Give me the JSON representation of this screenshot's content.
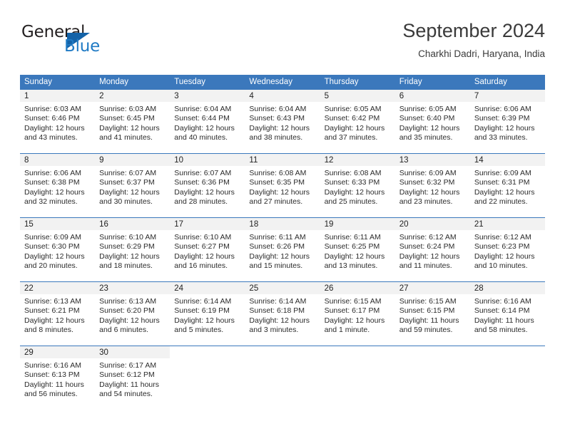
{
  "brand": {
    "name_part1": "General",
    "name_part2": "Blue",
    "triangle_icon": "triangle-icon",
    "accent_color": "#1463a8",
    "text_color": "#231f20"
  },
  "header": {
    "title": "September 2024",
    "subtitle": "Charkhi Dadri, Haryana, India"
  },
  "calendar": {
    "header_bg": "#3b78bc",
    "daynum_bg": "#f2f2f2",
    "weekdays": [
      "Sunday",
      "Monday",
      "Tuesday",
      "Wednesday",
      "Thursday",
      "Friday",
      "Saturday"
    ],
    "weeks": [
      [
        {
          "day": "1",
          "sunrise": "Sunrise: 6:03 AM",
          "sunset": "Sunset: 6:46 PM",
          "daylight1": "Daylight: 12 hours",
          "daylight2": "and 43 minutes."
        },
        {
          "day": "2",
          "sunrise": "Sunrise: 6:03 AM",
          "sunset": "Sunset: 6:45 PM",
          "daylight1": "Daylight: 12 hours",
          "daylight2": "and 41 minutes."
        },
        {
          "day": "3",
          "sunrise": "Sunrise: 6:04 AM",
          "sunset": "Sunset: 6:44 PM",
          "daylight1": "Daylight: 12 hours",
          "daylight2": "and 40 minutes."
        },
        {
          "day": "4",
          "sunrise": "Sunrise: 6:04 AM",
          "sunset": "Sunset: 6:43 PM",
          "daylight1": "Daylight: 12 hours",
          "daylight2": "and 38 minutes."
        },
        {
          "day": "5",
          "sunrise": "Sunrise: 6:05 AM",
          "sunset": "Sunset: 6:42 PM",
          "daylight1": "Daylight: 12 hours",
          "daylight2": "and 37 minutes."
        },
        {
          "day": "6",
          "sunrise": "Sunrise: 6:05 AM",
          "sunset": "Sunset: 6:40 PM",
          "daylight1": "Daylight: 12 hours",
          "daylight2": "and 35 minutes."
        },
        {
          "day": "7",
          "sunrise": "Sunrise: 6:06 AM",
          "sunset": "Sunset: 6:39 PM",
          "daylight1": "Daylight: 12 hours",
          "daylight2": "and 33 minutes."
        }
      ],
      [
        {
          "day": "8",
          "sunrise": "Sunrise: 6:06 AM",
          "sunset": "Sunset: 6:38 PM",
          "daylight1": "Daylight: 12 hours",
          "daylight2": "and 32 minutes."
        },
        {
          "day": "9",
          "sunrise": "Sunrise: 6:07 AM",
          "sunset": "Sunset: 6:37 PM",
          "daylight1": "Daylight: 12 hours",
          "daylight2": "and 30 minutes."
        },
        {
          "day": "10",
          "sunrise": "Sunrise: 6:07 AM",
          "sunset": "Sunset: 6:36 PM",
          "daylight1": "Daylight: 12 hours",
          "daylight2": "and 28 minutes."
        },
        {
          "day": "11",
          "sunrise": "Sunrise: 6:08 AM",
          "sunset": "Sunset: 6:35 PM",
          "daylight1": "Daylight: 12 hours",
          "daylight2": "and 27 minutes."
        },
        {
          "day": "12",
          "sunrise": "Sunrise: 6:08 AM",
          "sunset": "Sunset: 6:33 PM",
          "daylight1": "Daylight: 12 hours",
          "daylight2": "and 25 minutes."
        },
        {
          "day": "13",
          "sunrise": "Sunrise: 6:09 AM",
          "sunset": "Sunset: 6:32 PM",
          "daylight1": "Daylight: 12 hours",
          "daylight2": "and 23 minutes."
        },
        {
          "day": "14",
          "sunrise": "Sunrise: 6:09 AM",
          "sunset": "Sunset: 6:31 PM",
          "daylight1": "Daylight: 12 hours",
          "daylight2": "and 22 minutes."
        }
      ],
      [
        {
          "day": "15",
          "sunrise": "Sunrise: 6:09 AM",
          "sunset": "Sunset: 6:30 PM",
          "daylight1": "Daylight: 12 hours",
          "daylight2": "and 20 minutes."
        },
        {
          "day": "16",
          "sunrise": "Sunrise: 6:10 AM",
          "sunset": "Sunset: 6:29 PM",
          "daylight1": "Daylight: 12 hours",
          "daylight2": "and 18 minutes."
        },
        {
          "day": "17",
          "sunrise": "Sunrise: 6:10 AM",
          "sunset": "Sunset: 6:27 PM",
          "daylight1": "Daylight: 12 hours",
          "daylight2": "and 16 minutes."
        },
        {
          "day": "18",
          "sunrise": "Sunrise: 6:11 AM",
          "sunset": "Sunset: 6:26 PM",
          "daylight1": "Daylight: 12 hours",
          "daylight2": "and 15 minutes."
        },
        {
          "day": "19",
          "sunrise": "Sunrise: 6:11 AM",
          "sunset": "Sunset: 6:25 PM",
          "daylight1": "Daylight: 12 hours",
          "daylight2": "and 13 minutes."
        },
        {
          "day": "20",
          "sunrise": "Sunrise: 6:12 AM",
          "sunset": "Sunset: 6:24 PM",
          "daylight1": "Daylight: 12 hours",
          "daylight2": "and 11 minutes."
        },
        {
          "day": "21",
          "sunrise": "Sunrise: 6:12 AM",
          "sunset": "Sunset: 6:23 PM",
          "daylight1": "Daylight: 12 hours",
          "daylight2": "and 10 minutes."
        }
      ],
      [
        {
          "day": "22",
          "sunrise": "Sunrise: 6:13 AM",
          "sunset": "Sunset: 6:21 PM",
          "daylight1": "Daylight: 12 hours",
          "daylight2": "and 8 minutes."
        },
        {
          "day": "23",
          "sunrise": "Sunrise: 6:13 AM",
          "sunset": "Sunset: 6:20 PM",
          "daylight1": "Daylight: 12 hours",
          "daylight2": "and 6 minutes."
        },
        {
          "day": "24",
          "sunrise": "Sunrise: 6:14 AM",
          "sunset": "Sunset: 6:19 PM",
          "daylight1": "Daylight: 12 hours",
          "daylight2": "and 5 minutes."
        },
        {
          "day": "25",
          "sunrise": "Sunrise: 6:14 AM",
          "sunset": "Sunset: 6:18 PM",
          "daylight1": "Daylight: 12 hours",
          "daylight2": "and 3 minutes."
        },
        {
          "day": "26",
          "sunrise": "Sunrise: 6:15 AM",
          "sunset": "Sunset: 6:17 PM",
          "daylight1": "Daylight: 12 hours",
          "daylight2": "and 1 minute."
        },
        {
          "day": "27",
          "sunrise": "Sunrise: 6:15 AM",
          "sunset": "Sunset: 6:15 PM",
          "daylight1": "Daylight: 11 hours",
          "daylight2": "and 59 minutes."
        },
        {
          "day": "28",
          "sunrise": "Sunrise: 6:16 AM",
          "sunset": "Sunset: 6:14 PM",
          "daylight1": "Daylight: 11 hours",
          "daylight2": "and 58 minutes."
        }
      ],
      [
        {
          "day": "29",
          "sunrise": "Sunrise: 6:16 AM",
          "sunset": "Sunset: 6:13 PM",
          "daylight1": "Daylight: 11 hours",
          "daylight2": "and 56 minutes."
        },
        {
          "day": "30",
          "sunrise": "Sunrise: 6:17 AM",
          "sunset": "Sunset: 6:12 PM",
          "daylight1": "Daylight: 11 hours",
          "daylight2": "and 54 minutes."
        },
        {
          "day": "",
          "sunrise": "",
          "sunset": "",
          "daylight1": "",
          "daylight2": ""
        },
        {
          "day": "",
          "sunrise": "",
          "sunset": "",
          "daylight1": "",
          "daylight2": ""
        },
        {
          "day": "",
          "sunrise": "",
          "sunset": "",
          "daylight1": "",
          "daylight2": ""
        },
        {
          "day": "",
          "sunrise": "",
          "sunset": "",
          "daylight1": "",
          "daylight2": ""
        },
        {
          "day": "",
          "sunrise": "",
          "sunset": "",
          "daylight1": "",
          "daylight2": ""
        }
      ]
    ]
  }
}
